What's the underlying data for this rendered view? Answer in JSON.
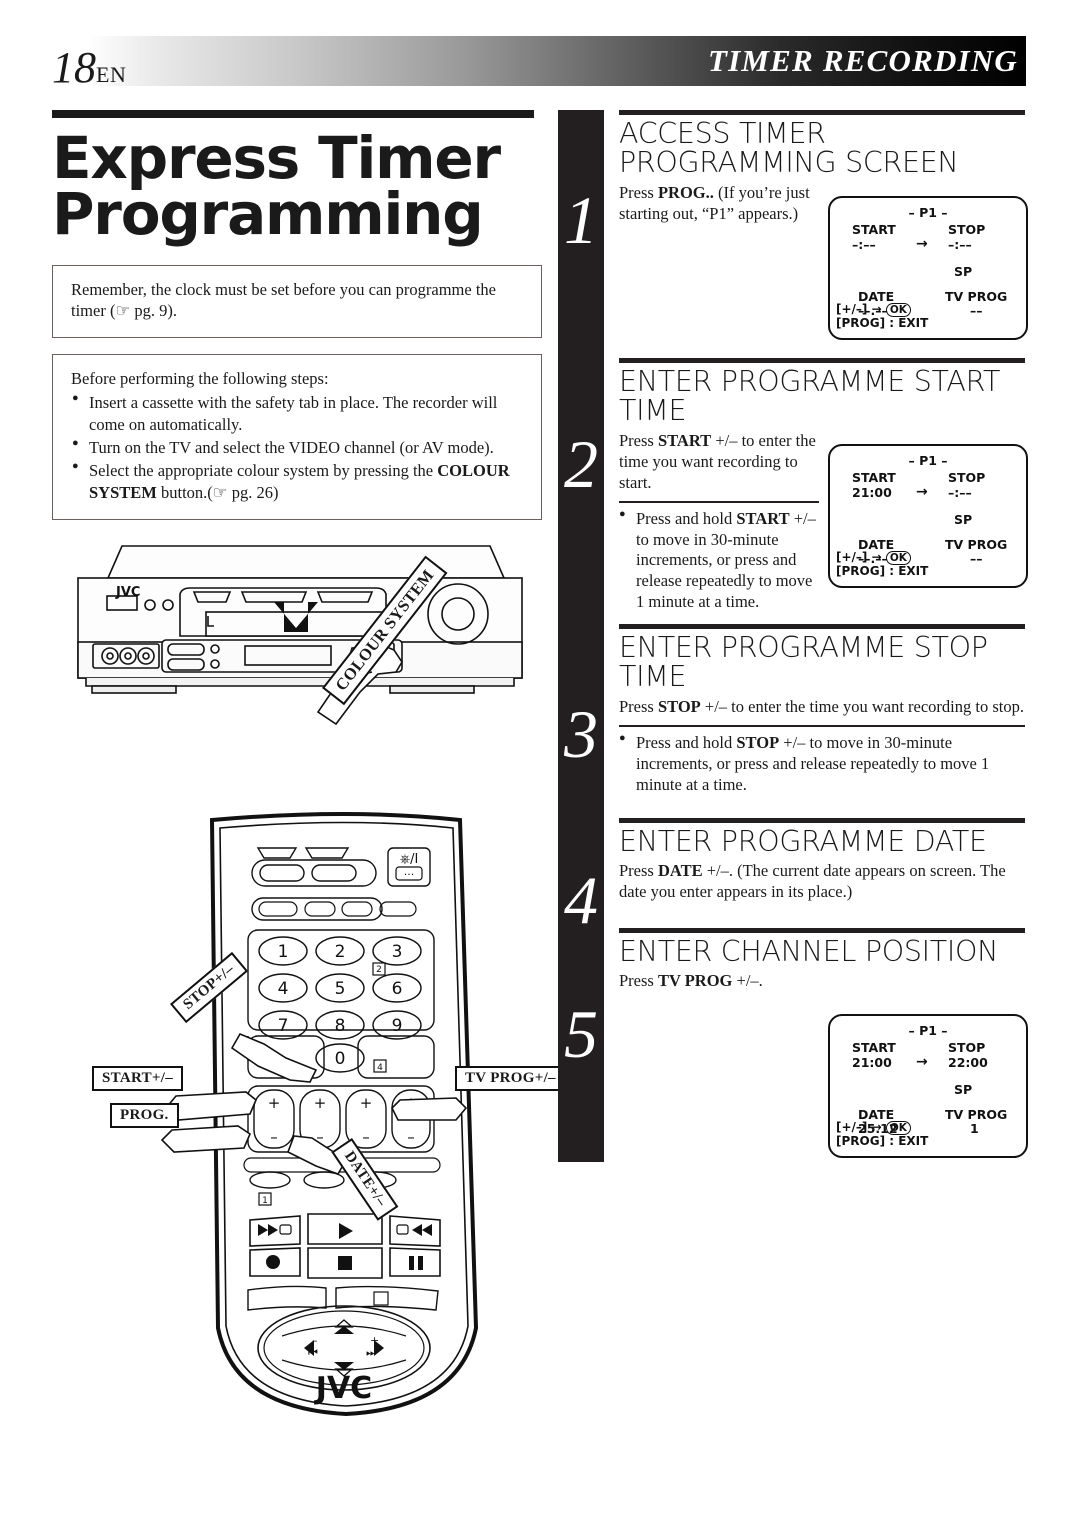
{
  "header": {
    "page_number": "18",
    "language": "EN",
    "section_title": "TIMER RECORDING"
  },
  "left": {
    "title_line1": "Express Timer",
    "title_line2": "Programming",
    "note1": "Remember, the clock must be set before you can programme the timer (☞ pg. 9).",
    "note2_intro": "Before performing the following steps:",
    "note2_bullets": [
      "Insert a cassette with the safety tab in place. The recorder will come on automatically.",
      "Turn on the TV and select the VIDEO channel (or AV mode).",
      "Select the appropriate colour system by pressing the COLOUR SYSTEM button.(☞ pg. 26)"
    ],
    "vcr_brand": "JVC",
    "vcr_callout": "COLOUR SYSTEM",
    "remote_brand": "JVC",
    "remote_callouts": {
      "stop": "STOP+/–",
      "start": "START+/–",
      "prog": "PROG.",
      "tv_prog": "TV PROG+/–",
      "date": "DATE+/–"
    },
    "remote_keys": [
      "1",
      "2",
      "3",
      "4",
      "5",
      "6",
      "7",
      "8",
      "9",
      "0"
    ],
    "remote_badges": [
      "1",
      "2",
      "4"
    ]
  },
  "steps": [
    {
      "number": "1",
      "heading": "ACCESS TIMER PROGRAMMING SCREEN",
      "body": "Press PROG.. (If you’re just starting out, “P1” appears.)",
      "bullets": []
    },
    {
      "number": "2",
      "heading": "ENTER PROGRAMME START TIME",
      "body": "Press START +/– to enter the time you want recording to start.",
      "bullets": [
        "Press and hold START +/– to move in 30-minute increments, or press and release repeatedly to move 1 minute at a time."
      ]
    },
    {
      "number": "3",
      "heading": "ENTER PROGRAMME STOP TIME",
      "body": "Press STOP +/– to enter the time you want recording to stop.",
      "bullets": [
        "Press and hold STOP +/– to move in 30-minute increments, or press and release repeatedly to move 1 minute at a time."
      ]
    },
    {
      "number": "4",
      "heading": "ENTER PROGRAMME DATE",
      "body": "Press DATE +/–. (The current date appears on screen. The date you enter appears in its place.)",
      "bullets": []
    },
    {
      "number": "5",
      "heading": "ENTER CHANNEL POSITION",
      "body": "Press TV PROG +/–.",
      "bullets": []
    }
  ],
  "osd_screens": [
    {
      "id": "osd-step1",
      "programme": "– P1 –",
      "start_label": "START",
      "start_value": "–:––",
      "arrow": "→",
      "stop_label": "STOP",
      "stop_value": "–:––",
      "speed": "SP",
      "date_label": "DATE",
      "date_value": "––.––",
      "tvprog_label": "TV PROG",
      "tvprog_value": "––",
      "footer1_pre": "[+/–] →",
      "footer1_ok": "OK",
      "footer2": "[PROG] : EXIT"
    },
    {
      "id": "osd-step2",
      "programme": "– P1 –",
      "start_label": "START",
      "start_value": "21:00",
      "arrow": "→",
      "stop_label": "STOP",
      "stop_value": "–:––",
      "speed": "SP",
      "date_label": "DATE",
      "date_value": "––.––",
      "tvprog_label": "TV PROG",
      "tvprog_value": "––",
      "footer1_pre": "[+/–] →",
      "footer1_ok": "OK",
      "footer2": "[PROG] : EXIT"
    },
    {
      "id": "osd-step5",
      "programme": "– P1 –",
      "start_label": "START",
      "start_value": "21:00",
      "arrow": "→",
      "stop_label": "STOP",
      "stop_value": "22:00",
      "speed": "SP",
      "date_label": "DATE",
      "date_value": "25.12",
      "tvprog_label": "TV PROG",
      "tvprog_value": "1",
      "footer1_pre": "[+/–] →",
      "footer1_ok": "OK",
      "footer2": "[PROG] : EXIT"
    }
  ],
  "colors": {
    "ink": "#1a1a1a",
    "bar": "#231f20",
    "note_border": "#6a5f5c"
  }
}
